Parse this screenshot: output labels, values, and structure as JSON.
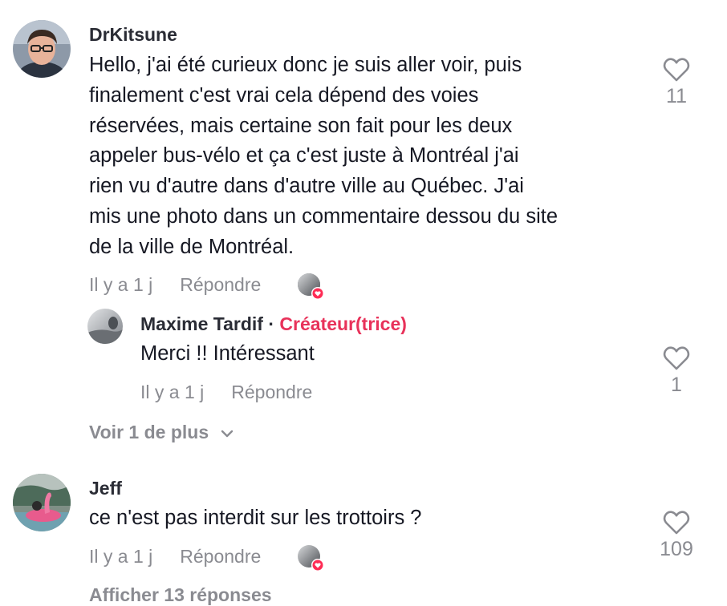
{
  "comments": [
    {
      "username": "DrKitsune",
      "text_lines": [
        "Hello, j'ai été curieux donc je suis aller voir, puis",
        "finalement c'est vrai cela dépend des voies",
        "réservées, mais certaine son fait pour les deux",
        "appeler bus-vélo et ça c'est juste à Montréal j'ai",
        "rien vu d'autre dans d'autre ville au Québec. J'ai",
        "mis une photo dans un commentaire dessou du site",
        "de la ville de Montréal."
      ],
      "time": "Il y a 1 j",
      "reply_label": "Répondre",
      "likes": "11",
      "reply": {
        "username": "Maxime Tardif",
        "separator": "·",
        "badge": "Créateur(trice)",
        "text": "Merci !! Intéressant",
        "time": "Il y a 1 j",
        "reply_label": "Répondre",
        "likes": "1"
      },
      "more_label": "Voir 1 de plus"
    },
    {
      "username": "Jeff",
      "text": "ce n'est pas interdit sur les trottoirs ?",
      "time": "Il y a 1 j",
      "reply_label": "Répondre",
      "likes": "109",
      "more_label": "Afficher 13 réponses"
    }
  ],
  "colors": {
    "creator_badge": "#e8325a",
    "muted": "#8a8b91",
    "text": "#161823",
    "heart_badge": "#fe2c55"
  },
  "icons": [
    "heart-outline-icon",
    "chevron-down-icon",
    "creator-liked-badge-icon"
  ]
}
